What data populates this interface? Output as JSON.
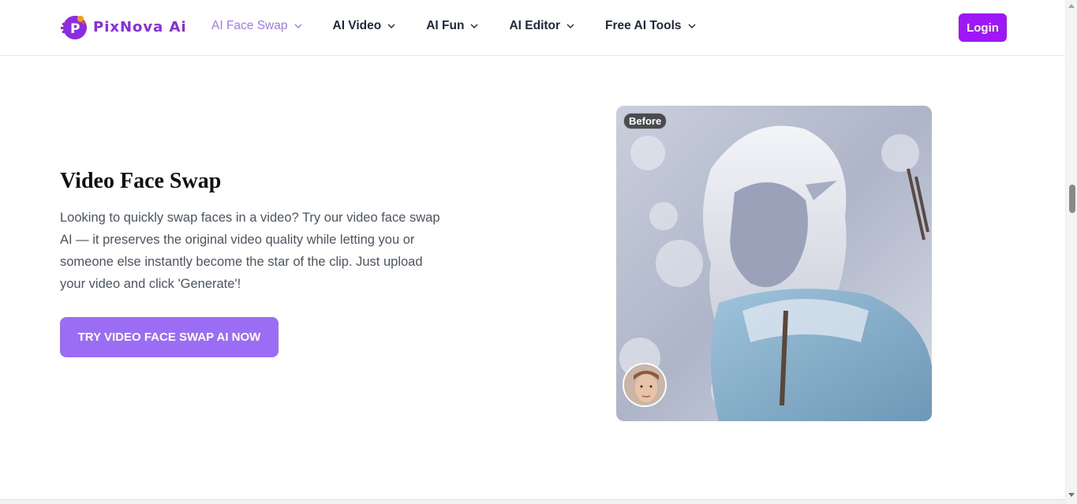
{
  "header": {
    "logo_text": "PixNova Ai",
    "nav": [
      {
        "label": "AI Face Swap",
        "active": true
      },
      {
        "label": "AI Video",
        "active": false
      },
      {
        "label": "AI Fun",
        "active": false
      },
      {
        "label": "AI Editor",
        "active": false
      },
      {
        "label": "Free AI Tools",
        "active": false
      }
    ],
    "login_label": "Login"
  },
  "hero": {
    "title": "Video Face Swap",
    "description": "Looking to quickly swap faces in a video? Try our video face swap AI — it preserves the original video quality while letting you or someone else instantly become the star of the clip. Just upload your video and click 'Generate'!",
    "cta_label": "TRY VIDEO FACE SWAP AI NOW",
    "preview_badge": "Before"
  },
  "colors": {
    "brand": "#9e18f7",
    "accent": "#9b6df5",
    "active_nav": "#a27af0"
  },
  "icons": [
    "logo-p-icon",
    "chevron-down-icon"
  ]
}
